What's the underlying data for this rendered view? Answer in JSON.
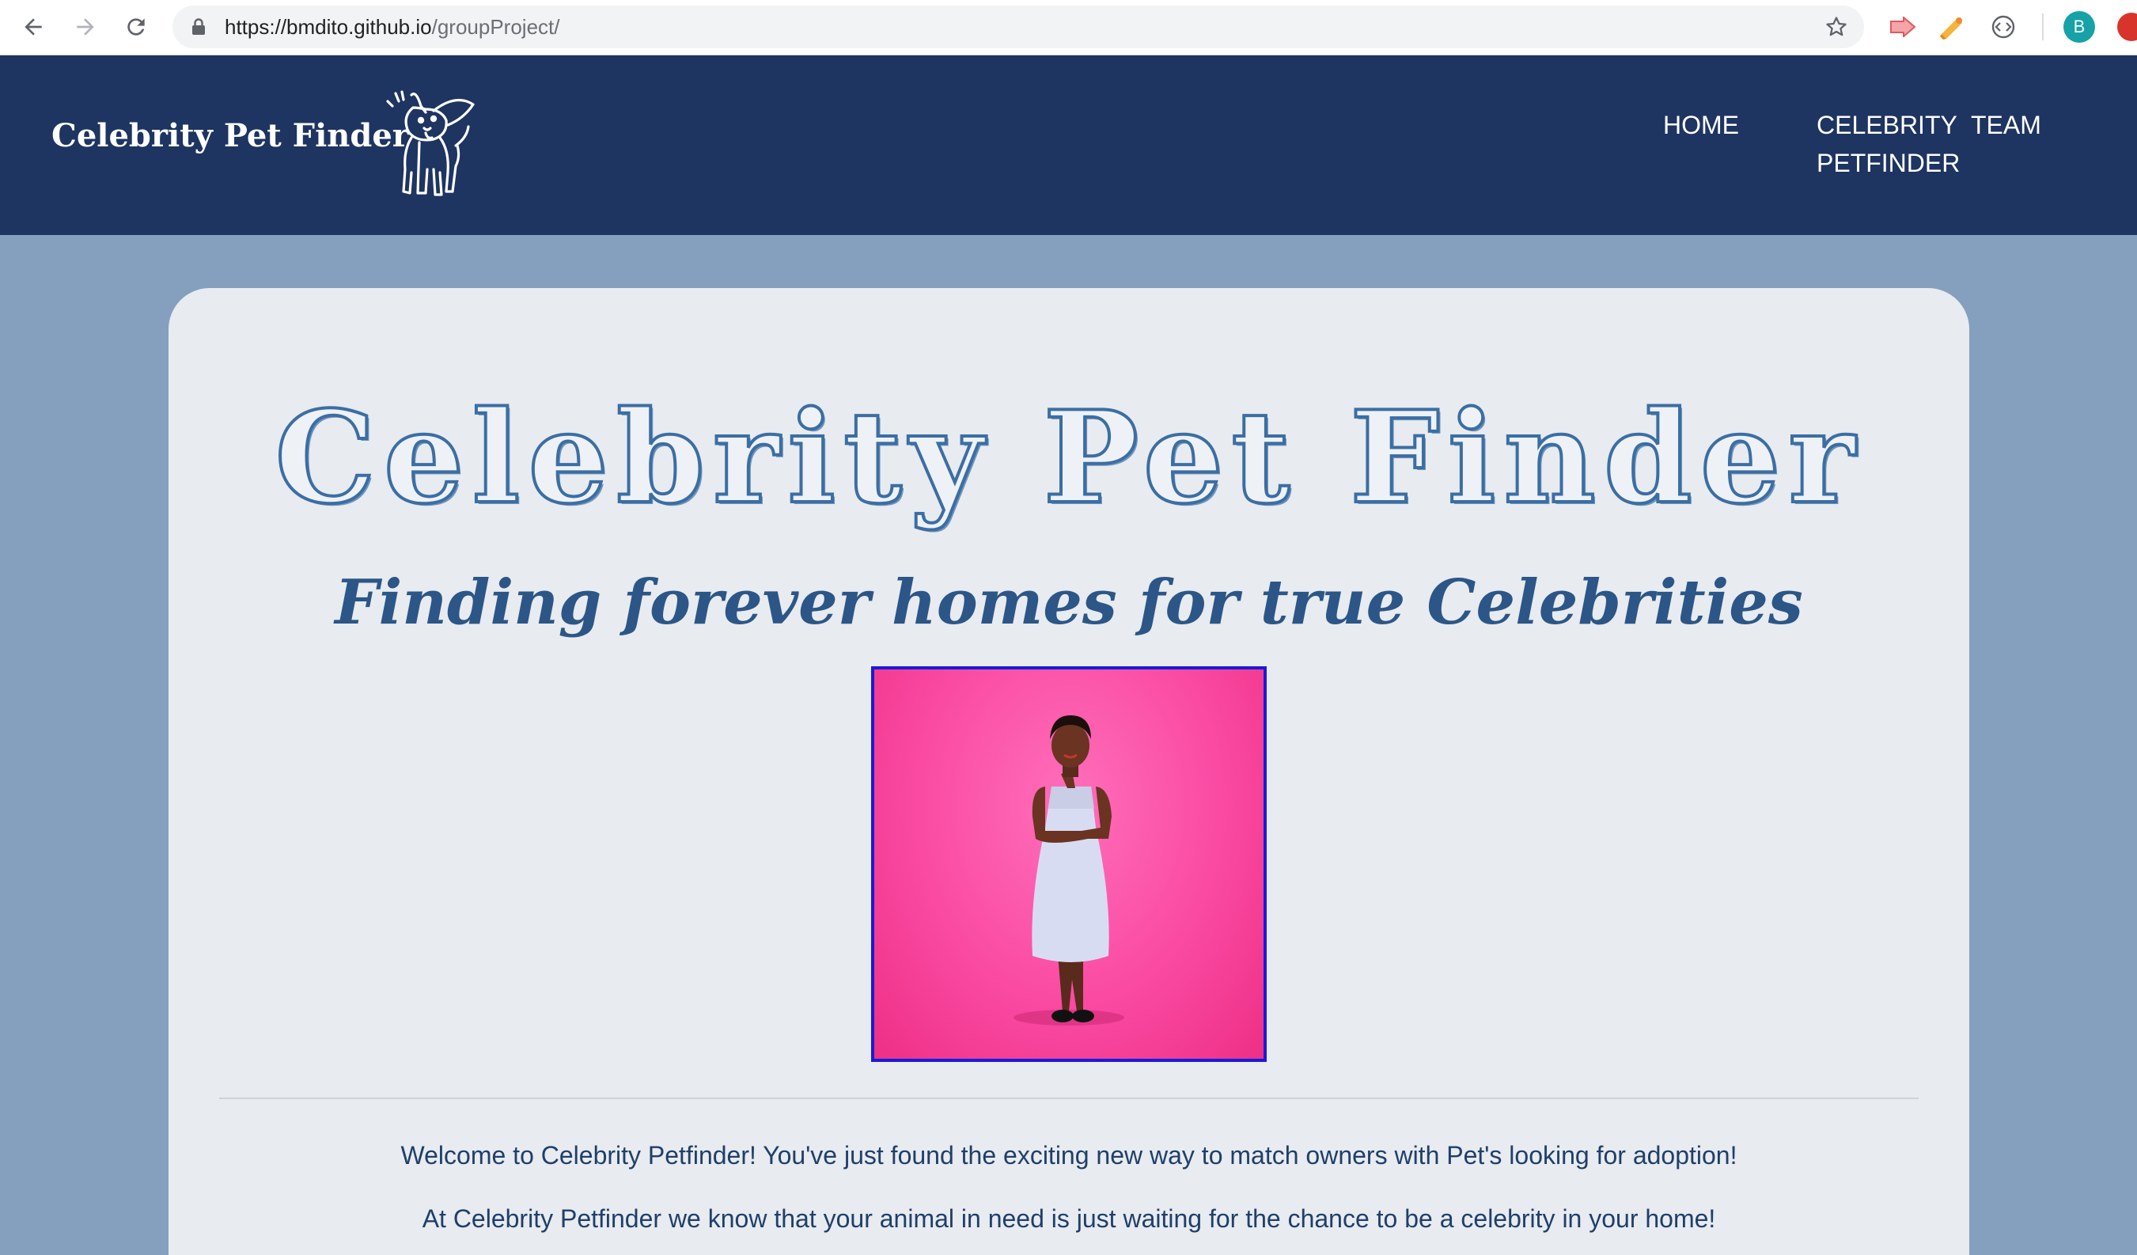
{
  "browser": {
    "url_host": "https://bmdito.github.io",
    "url_path": "/groupProject/",
    "profile_initial": "B",
    "icons": [
      "back-arrow-icon",
      "forward-arrow-icon",
      "reload-icon",
      "lock-icon",
      "bookmark-star-icon",
      "extension-icons",
      "profile-avatar"
    ]
  },
  "header": {
    "brand": "Celebrity Pet Finder",
    "logo_icon": "dog-icon",
    "nav": {
      "home": "HOME",
      "celebrity_line1": "CELEBRITY",
      "celebrity_line2": "PETFINDER",
      "team": "TEAM"
    }
  },
  "main": {
    "title": "Celebrity Pet Finder",
    "subtitle": "Finding forever homes for true Celebrities",
    "photo_icon": "hero-photo",
    "paragraph_1": "Welcome to Celebrity Petfinder! You've just found the exciting new way to match owners with Pet's looking for adoption!",
    "paragraph_2": "At Celebrity Petfinder we know that your animal in need is just waiting for the chance to be a celebrity in your home!"
  },
  "colors": {
    "header_bg": "#1e3461",
    "page_bg": "#84a0be",
    "card_bg": "#e8ebef",
    "title_color": "#3b6ea3",
    "text_color": "#1f3f6a",
    "photo_border": "#1a1ad8",
    "photo_bg": "#fa4aa2"
  }
}
